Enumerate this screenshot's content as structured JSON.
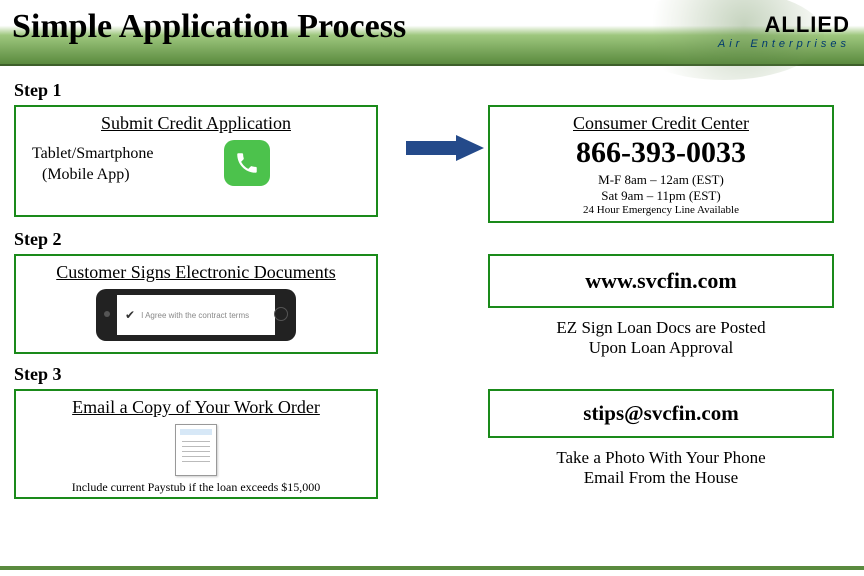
{
  "header": {
    "title": "Simple Application Process",
    "logo_main": "ALLIED",
    "logo_sub": "Air Enterprises"
  },
  "step1": {
    "label": "Step 1",
    "left_title": "Submit Credit Application",
    "mobile_label_l1": "Tablet/Smartphone",
    "mobile_label_l2": "(Mobile App)",
    "right_title": "Consumer Credit Center",
    "phone": "866-393-0033",
    "hours_1": "M-F 8am – 12am (EST)",
    "hours_2": "Sat 9am – 11pm (EST)",
    "hours_3": "24 Hour Emergency Line Available"
  },
  "step2": {
    "label": "Step 2",
    "left_title": "Customer Signs Electronic Documents",
    "device_text": "I Agree with the contract terms",
    "right_www": "www.svcfin.com",
    "right_note_l1": "EZ Sign Loan Docs are Posted",
    "right_note_l2": "Upon Loan Approval"
  },
  "step3": {
    "label": "Step 3",
    "left_title": "Email a Copy of Your Work Order",
    "footnote": "Include current Paystub if the loan exceeds $15,000",
    "right_email": "stips@svcfin.com",
    "right_note_l1": "Take a Photo With Your Phone",
    "right_note_l2": "Email From the House"
  }
}
